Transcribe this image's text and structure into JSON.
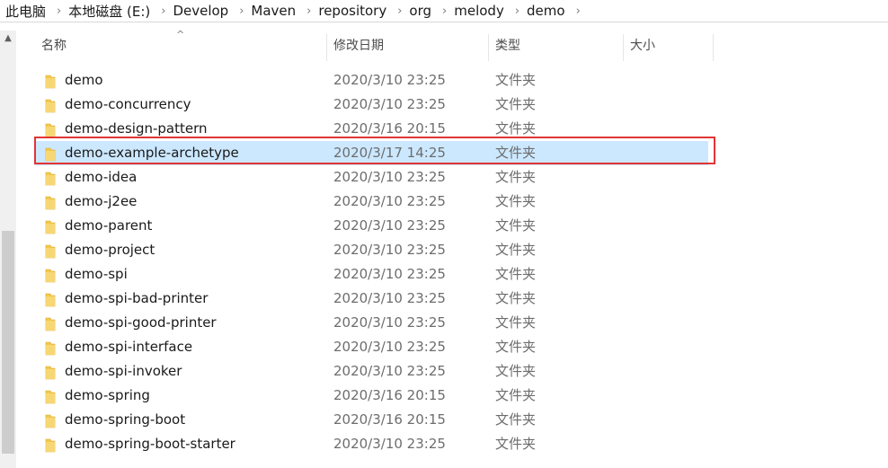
{
  "breadcrumb": [
    "此电脑",
    "本地磁盘 (E:)",
    "Develop",
    "Maven",
    "repository",
    "org",
    "melody",
    "demo"
  ],
  "columns": {
    "name": "名称",
    "date": "修改日期",
    "type": "类型",
    "size": "大小"
  },
  "rows": [
    {
      "name": "demo",
      "date": "2020/3/10 23:25",
      "type": "文件夹"
    },
    {
      "name": "demo-concurrency",
      "date": "2020/3/10 23:25",
      "type": "文件夹"
    },
    {
      "name": "demo-design-pattern",
      "date": "2020/3/16 20:15",
      "type": "文件夹"
    },
    {
      "name": "demo-example-archetype",
      "date": "2020/3/17 14:25",
      "type": "文件夹",
      "selected": true
    },
    {
      "name": "demo-idea",
      "date": "2020/3/10 23:25",
      "type": "文件夹"
    },
    {
      "name": "demo-j2ee",
      "date": "2020/3/10 23:25",
      "type": "文件夹"
    },
    {
      "name": "demo-parent",
      "date": "2020/3/10 23:25",
      "type": "文件夹"
    },
    {
      "name": "demo-project",
      "date": "2020/3/10 23:25",
      "type": "文件夹"
    },
    {
      "name": "demo-spi",
      "date": "2020/3/10 23:25",
      "type": "文件夹"
    },
    {
      "name": "demo-spi-bad-printer",
      "date": "2020/3/10 23:25",
      "type": "文件夹"
    },
    {
      "name": "demo-spi-good-printer",
      "date": "2020/3/10 23:25",
      "type": "文件夹"
    },
    {
      "name": "demo-spi-interface",
      "date": "2020/3/10 23:25",
      "type": "文件夹"
    },
    {
      "name": "demo-spi-invoker",
      "date": "2020/3/10 23:25",
      "type": "文件夹"
    },
    {
      "name": "demo-spring",
      "date": "2020/3/16 20:15",
      "type": "文件夹"
    },
    {
      "name": "demo-spring-boot",
      "date": "2020/3/16 20:15",
      "type": "文件夹"
    },
    {
      "name": "demo-spring-boot-starter",
      "date": "2020/3/10 23:25",
      "type": "文件夹"
    }
  ],
  "colors": {
    "selected_bg": "#cce8ff",
    "highlight_border": "#e03535",
    "folder": "#f2c94c"
  },
  "icons": {
    "folder": "folder-icon",
    "breadcrumb_separator": "chevron-right-icon",
    "sort": "sort-ascending-icon"
  }
}
